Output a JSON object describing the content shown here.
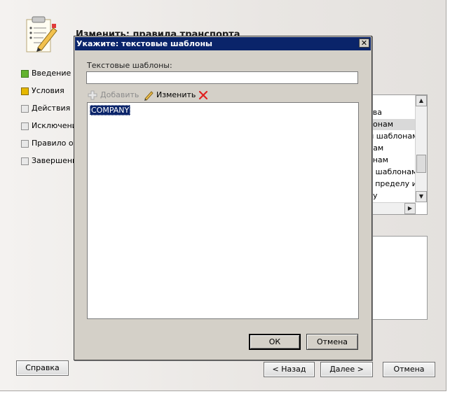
{
  "wizard": {
    "title": "Изменить: правила транспорта",
    "steps": [
      {
        "label": "Введение",
        "state": "done"
      },
      {
        "label": "Условия",
        "state": "current"
      },
      {
        "label": "Действия",
        "state": "pending"
      },
      {
        "label": "Исключения",
        "state": "pending"
      },
      {
        "label": "Правило об",
        "state": "pending"
      },
      {
        "label": "Завершение",
        "state": "pending"
      }
    ],
    "conditions_list": [
      "ова",
      "лонам",
      "м шаблонам",
      "нам",
      "онам",
      "и шаблонам",
      "а пределу и.",
      "лу"
    ],
    "selected_condition_index": 1,
    "buttons": {
      "help": "Справка",
      "back": "< Назад",
      "next": "Далее >",
      "cancel": "Отмена"
    }
  },
  "dialog": {
    "title": "Укажите: текстовые шаблоны",
    "close_symbol": "✕",
    "field_label": "Текстовые шаблоны:",
    "input_value": "",
    "toolbar": {
      "add": "Добавить",
      "edit": "Изменить"
    },
    "items": [
      "COMPANY"
    ],
    "selected_item_index": 0,
    "ok": "ОК",
    "cancel": "Отмена"
  },
  "colors": {
    "titlebar": "#0a246a",
    "selection": "#0a246a",
    "dialog_face": "#d4d0c8",
    "step_done": "#63b32e",
    "step_current": "#e6b800",
    "delete_icon": "#e02020"
  }
}
